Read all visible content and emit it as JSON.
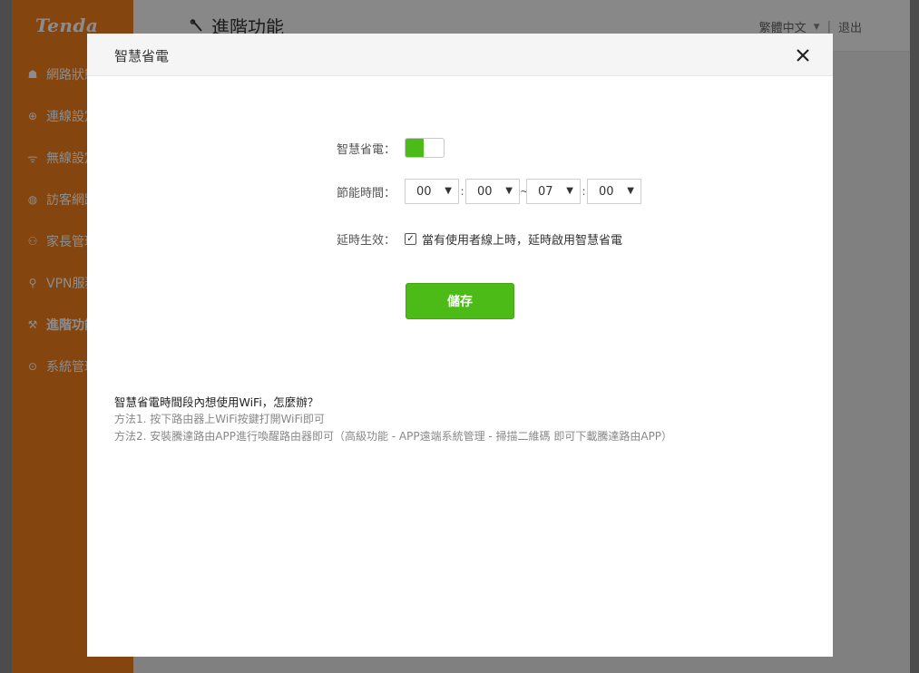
{
  "app": {
    "logo": "Tenda",
    "page_title": "進階功能",
    "language": "繁體中文",
    "logout": "退出",
    "sidebar": [
      {
        "label": "網路狀態",
        "icon": "network-status-icon",
        "glyph": "☗"
      },
      {
        "label": "連線設定",
        "icon": "globe-icon",
        "glyph": "⊕"
      },
      {
        "label": "無線設定",
        "icon": "wifi-icon",
        "glyph": "ᯤ"
      },
      {
        "label": "訪客網路",
        "icon": "guest-icon",
        "glyph": "◍"
      },
      {
        "label": "家長管理",
        "icon": "parents-icon",
        "glyph": "⚇"
      },
      {
        "label": "VPN服務",
        "icon": "vpn-icon",
        "glyph": "⚲"
      },
      {
        "label": "進階功能",
        "icon": "wrench-icon",
        "glyph": "⚒"
      },
      {
        "label": "系統管理",
        "icon": "system-icon",
        "glyph": "⊙"
      }
    ]
  },
  "modal": {
    "title": "智慧省電",
    "enable_label": "智慧省電：",
    "enable_on": true,
    "time_label": "節能時間：",
    "time": {
      "start_hour": "00",
      "start_min": "00",
      "end_hour": "07",
      "end_min": "00"
    },
    "colon": ":",
    "tilde": "~",
    "delay_label": "延時生效：",
    "delay_checked": true,
    "delay_text": "當有使用者線上時，延時啟用智慧省電",
    "save_label": "儲存",
    "help_question": "智慧省電時間段內想使用WiFi，怎麼辦？",
    "help_method1": "方法1. 按下路由器上WiFi按鍵打開WiFi即可",
    "help_method2": "方法2. 安裝騰達路由APP進行喚醒路由器即可（高級功能 - APP遠端系統管理 - 掃描二維碼 即可下載騰達路由APP）"
  },
  "colors": {
    "accent_green": "#4cbb17",
    "sidebar_orange": "#f07f1c"
  }
}
